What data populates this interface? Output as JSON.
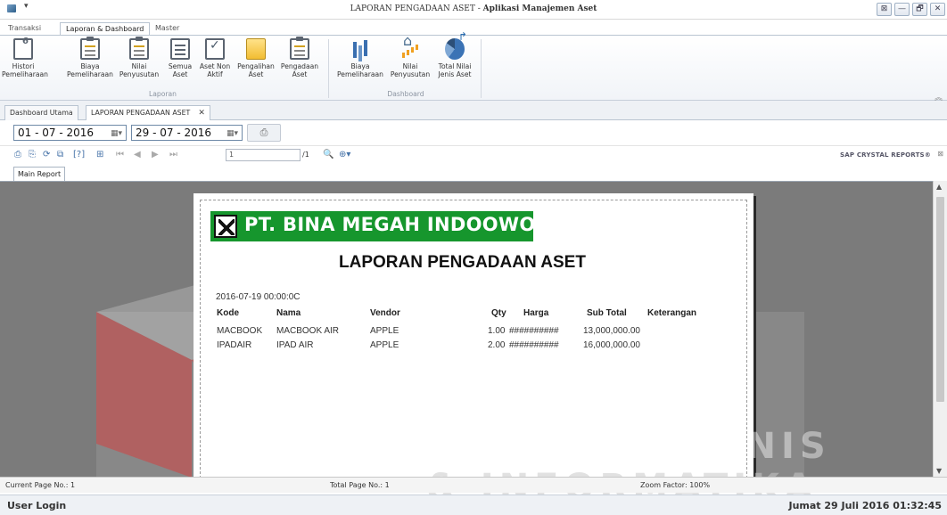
{
  "window": {
    "title_prefix": "LAPORAN PENGADAAN ASET - ",
    "title_app": "Aplikasi Manajemen Aset",
    "quick_access": "▾",
    "buttons": {
      "restore": "⊠",
      "minimize": "—",
      "maximize": "🗗",
      "close": "✕"
    }
  },
  "ribbon_tabs": [
    "Transaksi",
    "Laporan & Dashboard",
    "Master"
  ],
  "ribbon": {
    "laporan": [
      {
        "label1": "Histori",
        "label2": "Pemeliharaan",
        "icon": "history-icon"
      },
      {
        "label1": "Biaya",
        "label2": "Pemeliharaan",
        "icon": "clipboard-icon"
      },
      {
        "label1": "Nilai",
        "label2": "Penyusutan",
        "icon": "clipboard-icon"
      },
      {
        "label1": "Semua",
        "label2": "Aset",
        "icon": "document-icon"
      },
      {
        "label1": "Aset Non",
        "label2": "Aktif",
        "icon": "checklist-icon"
      },
      {
        "label1": "Pengalihan",
        "label2": "Aset",
        "icon": "folder-icon"
      },
      {
        "label1": "Pengadaan",
        "label2": "Aset",
        "icon": "clipboard-icon"
      }
    ],
    "laporan_group_label": "Laporan",
    "dashboard": [
      {
        "label1": "Biaya",
        "label2": "Pemeliharaan",
        "icon": "bar-chart-icon"
      },
      {
        "label1": "Nilai",
        "label2": "Penyusutan",
        "icon": "trend-chart-icon"
      },
      {
        "label1": "Total Nilai",
        "label2": "Jenis Aset",
        "icon": "pie-chart-icon"
      }
    ],
    "dashboard_group_label": "Dashboard",
    "collapse_glyph": "︽"
  },
  "doc_tabs": [
    {
      "label": "Dashboard Utama",
      "closable": false
    },
    {
      "label": "LAPORAN PENGADAAN ASET",
      "closable": true
    }
  ],
  "close_glyph": "✕",
  "filter": {
    "date_from": "01 - 07 - 2016",
    "date_to": "29 - 07 - 2016",
    "calendar_glyph": "▦▾",
    "print_glyph": "⎙"
  },
  "crystal_toolbar": {
    "icons": [
      "⎙",
      "⎘",
      "⟳",
      "⧉",
      "[?]",
      "⊞",
      "⏮",
      "◀",
      "▶",
      "⏭"
    ],
    "page_input": "1",
    "page_total": "/1",
    "find_glyph": "🔍",
    "zoom_glyph": "⊕▾",
    "brand": "SAP CRYSTAL REPORTS®",
    "close_glyph": "⊠"
  },
  "main_report_tab": "Main Report",
  "report": {
    "company": "PT. BINA MEGAH INDOOWOOD",
    "title": "LAPORAN PENGADAAN ASET",
    "date": "2016-07-19  00:00:0C",
    "columns": [
      "Kode",
      "Nama",
      "Vendor",
      "Qty",
      "Harga",
      "Sub Total",
      "Keterangan"
    ],
    "rows": [
      {
        "kode": "MACBOOK",
        "nama": "MACBOOK AIR",
        "vendor": "APPLE",
        "qty": "1.00",
        "harga": "##########",
        "subtotal": "13,000,000.00",
        "keterangan": ""
      },
      {
        "kode": "IPADAIR",
        "nama": "IPAD AIR",
        "vendor": "APPLE",
        "qty": "2.00",
        "harga": "##########",
        "subtotal": "16,000,000.00",
        "keterangan": ""
      }
    ]
  },
  "watermark": {
    "line1": "INSTITUT BISNIS",
    "line2": "& INFORMATIKA"
  },
  "crystal_status": {
    "current_page": "Current Page No.: 1",
    "total_page": "Total Page No.: 1",
    "zoom": "Zoom Factor: 100%"
  },
  "app_status": {
    "user": "User Login",
    "datetime": "Jumat  29 Juli 2016  01:32:45"
  }
}
